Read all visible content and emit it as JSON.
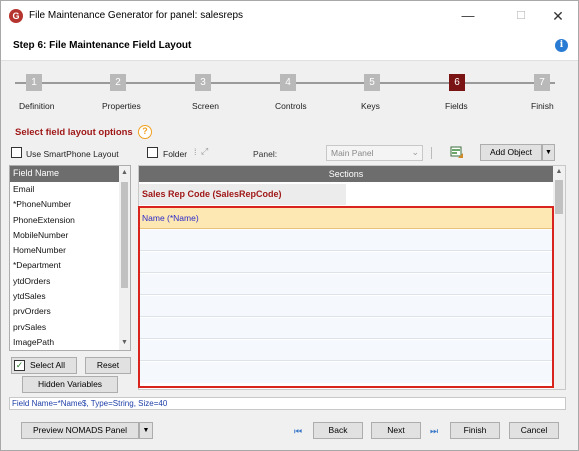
{
  "window": {
    "title": "File Maintenance Generator for panel: salesreps",
    "minimize": "—",
    "maximize": "☐",
    "close": "✕"
  },
  "header": {
    "title": "Step 6: File Maintenance Field Layout",
    "info_icon": "i"
  },
  "steps": [
    {
      "num": "1",
      "label": "Definition",
      "active": false
    },
    {
      "num": "2",
      "label": "Properties",
      "active": false
    },
    {
      "num": "3",
      "label": "Screen",
      "active": false
    },
    {
      "num": "4",
      "label": "Controls",
      "active": false
    },
    {
      "num": "5",
      "label": "Keys",
      "active": false
    },
    {
      "num": "6",
      "label": "Fields",
      "active": true
    },
    {
      "num": "7",
      "label": "Finish",
      "active": false
    }
  ],
  "options": {
    "title": "Select field layout options",
    "help_icon": "?",
    "smartphone_label": "Use SmartPhone Layout",
    "smartphone_checked": false,
    "folder_label": "Folder",
    "folder_checked": false,
    "panel_label": "Panel:",
    "panel_value": "Main Panel",
    "add_object_label": "Add Object",
    "add_object_arrow": "▼"
  },
  "field_list": {
    "header": "Field Name",
    "items": [
      "Email",
      "*PhoneNumber",
      "PhoneExtension",
      "MobileNumber",
      "HomeNumber",
      "*Department",
      "ytdOrders",
      "ytdSales",
      "prvOrders",
      "prvSales",
      "ImagePath"
    ],
    "select_all_label": "Select All",
    "select_all_checked": true,
    "reset_label": "Reset",
    "hidden_vars_label": "Hidden Variables"
  },
  "sections": {
    "header": "Sections",
    "section_name": "Sales Rep Code (SalesRepCode)",
    "layout_rows": [
      "Name (*Name)",
      "",
      "",
      "",
      "",
      "",
      "",
      ""
    ]
  },
  "status": {
    "text": "Field Name=*Name$,  Type=String,  Size=40"
  },
  "buttons": {
    "preview": "Preview NOMADS Panel",
    "preview_arrow": "▼",
    "back": "Back",
    "next": "Next",
    "finish": "Finish",
    "cancel": "Cancel"
  },
  "colors": {
    "accent_red": "#a01818",
    "active_step": "#7a1313",
    "highlight_border": "#d9241e",
    "selected_row": "#fde7b3"
  }
}
